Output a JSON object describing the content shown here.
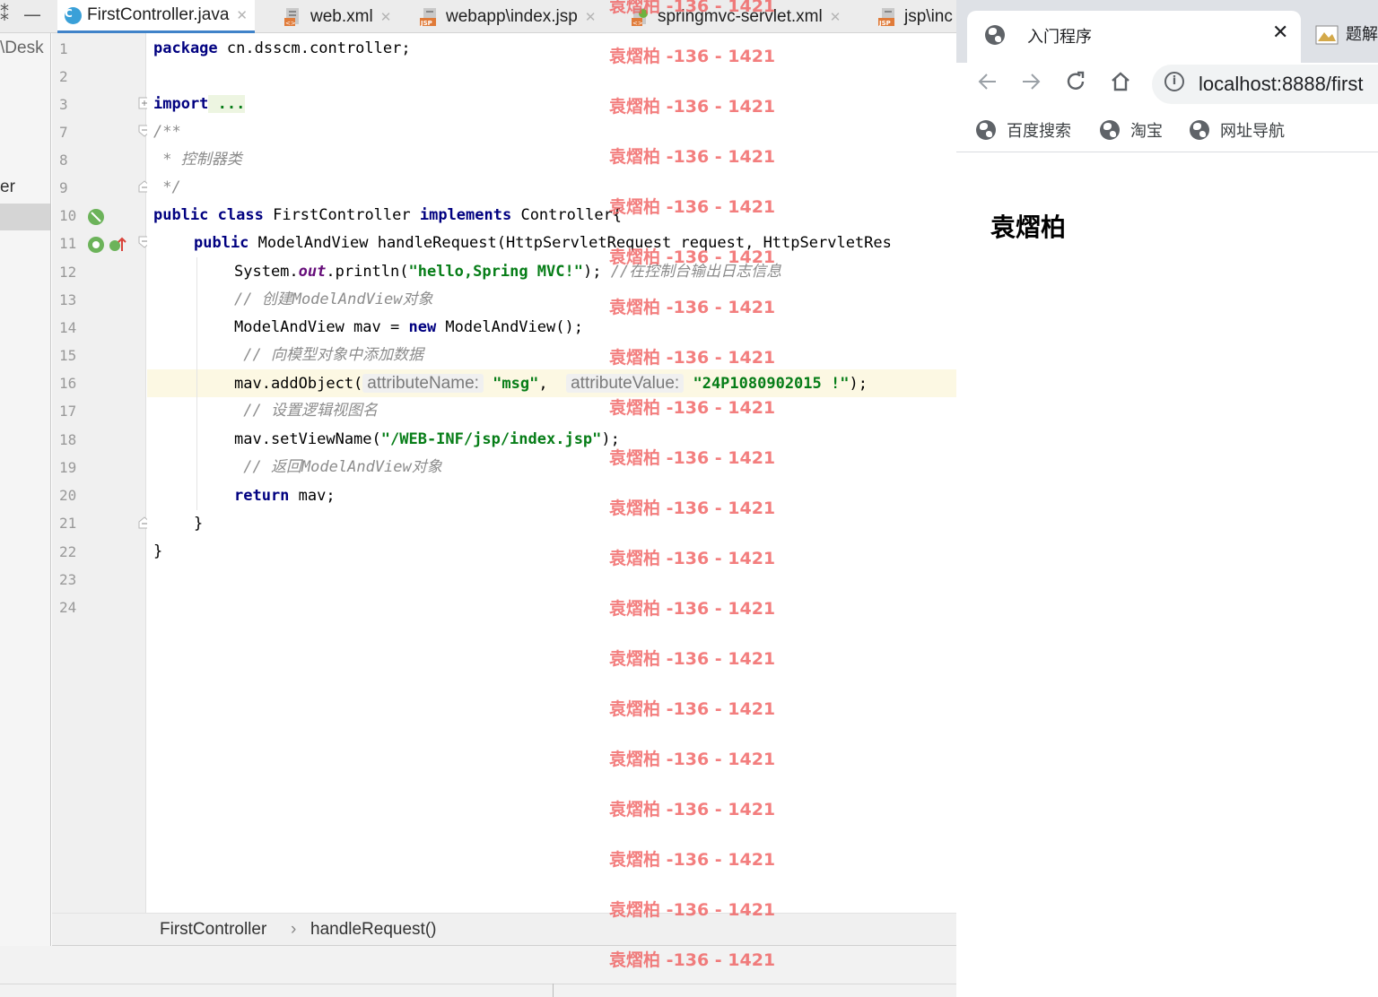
{
  "ide": {
    "tabs": [
      {
        "label": "FirstController.java",
        "active": true
      },
      {
        "label": "web.xml",
        "active": false
      },
      {
        "label": "webapp\\index.jsp",
        "active": false
      },
      {
        "label": "springmvc-servlet.xml",
        "active": false
      },
      {
        "label": "jsp\\inc",
        "active": false
      }
    ],
    "project_path_fragment": "\\Desk",
    "project_item_fragment": "er",
    "line_numbers": [
      "1",
      "2",
      "3",
      "7",
      "8",
      "9",
      "10",
      "11",
      "12",
      "13",
      "14",
      "15",
      "16",
      "17",
      "18",
      "19",
      "20",
      "21",
      "22",
      "23",
      "24"
    ],
    "code": {
      "l1_kw": "package",
      "l1_rest": " cn.dsscm.controller;",
      "l3_kw": "import",
      "l3_rest": " ...",
      "l7": "/**",
      "l8": " * 控制器类",
      "l9": " */",
      "l10_kw1": "public",
      "l10_kw2": "class",
      "l10_name": " FirstController ",
      "l10_kw3": "implements",
      "l10_rest": " Controller{",
      "l11_kw": "public",
      "l11_rest": " ModelAndView handleRequest(HttpServletRequest request, HttpServletRes",
      "l12_a": "System.",
      "l12_field": "out",
      "l12_b": ".println(",
      "l12_str": "\"hello,Spring MVC!\"",
      "l12_c": "); ",
      "l12_cmt": "//在控制台输出日志信息",
      "l13_cmt": "// 创建ModelAndView对象",
      "l14_a": "ModelAndView mav = ",
      "l14_kw": "new",
      "l14_b": " ModelAndView();",
      "l15_cmt": " // 向模型对象中添加数据",
      "l16_a": "mav.addObject(",
      "l16_hint1": "attributeName:",
      "l16_str1": "\"msg\"",
      "l16_comma": ",",
      "l16_hint2": "attributeValue:",
      "l16_str2": "\"24P1080902015 !\"",
      "l16_end": ");",
      "l17_cmt": " // 设置逻辑视图名",
      "l18_a": "mav.setViewName(",
      "l18_str": "\"/WEB-INF/jsp/index.jsp\"",
      "l18_end": ");",
      "l19_cmt": " // 返回ModelAndView对象",
      "l20_kw": "return",
      "l20_rest": " mav;",
      "l21": "}",
      "l22": "}"
    },
    "breadcrumb": {
      "class_name": "FirstController",
      "separator": "›",
      "method_name": "handleRequest()"
    }
  },
  "browser": {
    "tab_title": "入门程序",
    "tab_close": "✕",
    "second_tab_fragment": "题解",
    "url": "localhost:8888/first",
    "bookmarks": [
      "百度搜索",
      "淘宝",
      "网址导航"
    ],
    "page_heading": "袁熠柏"
  },
  "watermark": {
    "text": "袁熠柏 -136 - 1421"
  },
  "colors": {
    "keyword": "#000080",
    "string": "#067d17",
    "comment": "#8c8c8c",
    "highlight_line": "#fcf8e3",
    "watermark": "#f05a5a",
    "active_tab_underline": "#4083c9"
  }
}
